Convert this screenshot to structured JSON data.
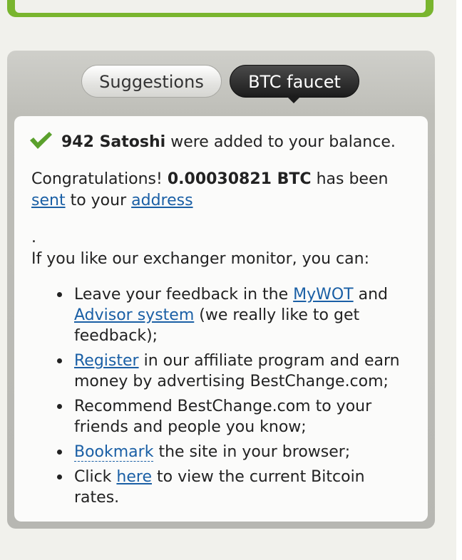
{
  "tabs": {
    "suggestions": "Suggestions",
    "btc_faucet": "BTC faucet"
  },
  "success": {
    "amount": "942 Satoshi",
    "text": "were added to your balance."
  },
  "congrats": {
    "prefix": "Congratulations!",
    "amount": "0.00030821 BTC",
    "middle": "has been",
    "link_sent": "sent",
    "mid2": "to your",
    "link_address": "address"
  },
  "dot": ".",
  "intro": "If you like our exchanger monitor, you can:",
  "items": [
    {
      "t1": "Leave your feedback in the",
      "link1": "MyWOT",
      "t2": "and",
      "link2": "Advisor system",
      "t3": "(we really like to get feedback);"
    },
    {
      "link": "Register",
      "text": "in our affiliate program and earn money by advertising BestChange.com;"
    },
    {
      "text": "Recommend BestChange.com to your friends and people you know;"
    },
    {
      "link": "Bookmark",
      "text": "the site in your browser;"
    },
    {
      "t1": "Click",
      "link": "here",
      "t2": "to view the current Bitcoin rates."
    }
  ],
  "colors": {
    "accent_green": "#79b52e",
    "link": "#1a5fa5",
    "check": "#5aa02c"
  }
}
